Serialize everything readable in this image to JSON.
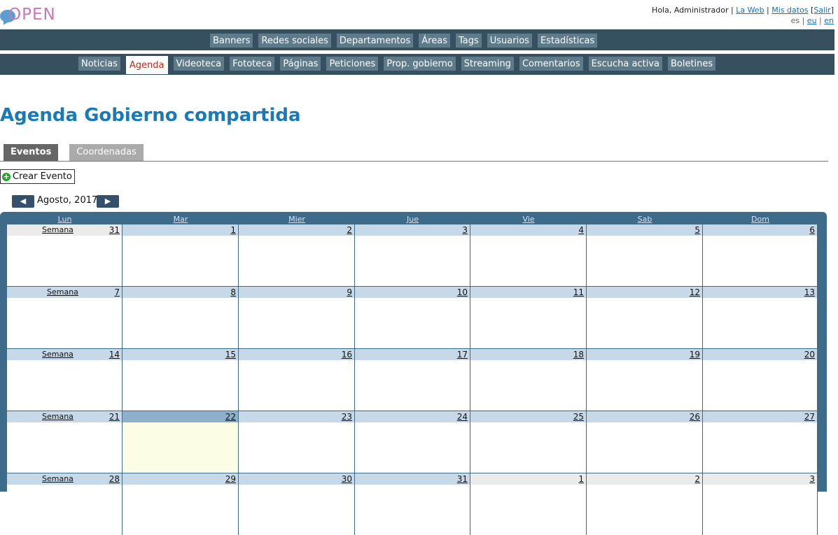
{
  "logo": {
    "text": "OPEN"
  },
  "user": {
    "greeting": "Hola, Administrador",
    "sep1": " | ",
    "la_web": "La Web",
    "sep2": " | ",
    "mis_datos": "Mis datos",
    "bracket_open": " [",
    "salir": "Salir",
    "bracket_close": "]"
  },
  "languages": {
    "es": "es",
    "sep1": " | ",
    "eu": "eu",
    "sep2": " | ",
    "en": "en"
  },
  "nav_primary": [
    {
      "label": "Banners"
    },
    {
      "label": "Redes sociales"
    },
    {
      "label": "Departamentos"
    },
    {
      "label": "Áreas"
    },
    {
      "label": "Tags"
    },
    {
      "label": "Usuarios"
    },
    {
      "label": "Estadísticas"
    }
  ],
  "nav_secondary": [
    {
      "label": "Noticias"
    },
    {
      "label": "Agenda",
      "active": true
    },
    {
      "label": "Videoteca"
    },
    {
      "label": "Fototeca"
    },
    {
      "label": "Páginas"
    },
    {
      "label": "Peticiones"
    },
    {
      "label": "Prop. gobierno"
    },
    {
      "label": "Streaming"
    },
    {
      "label": "Comentarios"
    },
    {
      "label": "Escucha activa"
    },
    {
      "label": "Boletines"
    }
  ],
  "page_title": "Agenda Gobierno compartida",
  "tabs": [
    {
      "label": "Eventos",
      "active": true
    },
    {
      "label": "Coordenadas",
      "active": false
    }
  ],
  "create_event_label": "Crear Evento",
  "month_nav": {
    "prev": "◀",
    "next": "▶",
    "label": "Agosto, 2017"
  },
  "calendar": {
    "day_headers": [
      "Lun",
      "Mar",
      "Mier",
      "Jue",
      "Vie",
      "Sab",
      "Dom"
    ],
    "week_label": "Semana",
    "today": "22",
    "weeks": [
      {
        "days": [
          "31",
          "1",
          "2",
          "3",
          "4",
          "5",
          "6"
        ],
        "other_month": [
          true,
          false,
          false,
          false,
          false,
          false,
          false
        ]
      },
      {
        "days": [
          "7",
          "8",
          "9",
          "10",
          "11",
          "12",
          "13"
        ],
        "other_month": [
          false,
          false,
          false,
          false,
          false,
          false,
          false
        ]
      },
      {
        "days": [
          "14",
          "15",
          "16",
          "17",
          "18",
          "19",
          "20"
        ],
        "other_month": [
          false,
          false,
          false,
          false,
          false,
          false,
          false
        ]
      },
      {
        "days": [
          "21",
          "22",
          "23",
          "24",
          "25",
          "26",
          "27"
        ],
        "other_month": [
          false,
          false,
          false,
          false,
          false,
          false,
          false
        ]
      },
      {
        "days": [
          "28",
          "29",
          "30",
          "31",
          "1",
          "2",
          "3"
        ],
        "other_month": [
          false,
          false,
          false,
          false,
          true,
          true,
          true
        ]
      }
    ]
  }
}
